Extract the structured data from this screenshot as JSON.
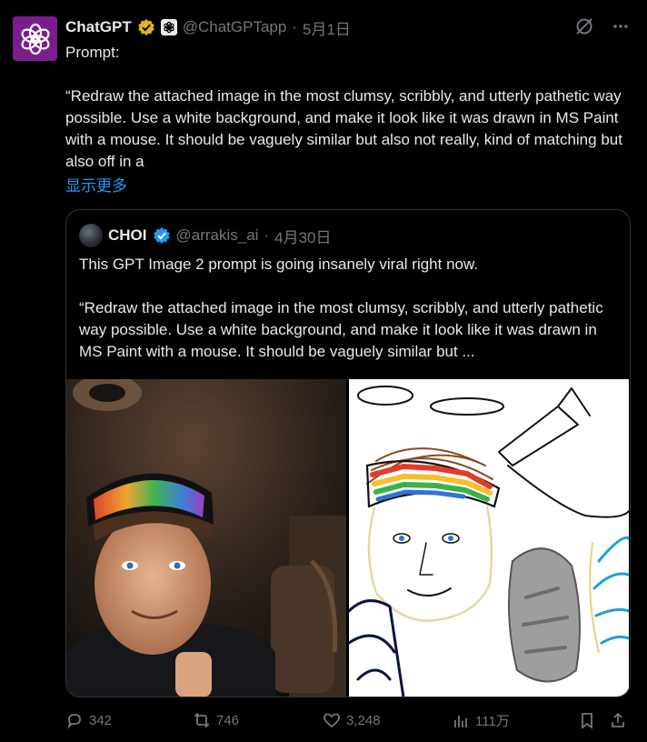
{
  "post": {
    "author_name": "ChatGPT",
    "handle": "@ChatGPTapp",
    "separator": "·",
    "date": "5月1日",
    "text_prompt_label": "Prompt:",
    "text_body": "“Redraw the attached image in the most clumsy, scribbly, and utterly pathetic way possible. Use a white background, and make it look like it was drawn in MS Paint with a mouse. It should be vaguely similar but also not really, kind of matching but also off in a",
    "show_more": "显示更多"
  },
  "quote": {
    "author_name": "CHOI",
    "handle": "@arrakis_ai",
    "separator": "·",
    "date": "4月30日",
    "line1": "This GPT Image 2 prompt is going insanely viral right now.",
    "line2": "“Redraw the attached image in the most clumsy, scribbly, and utterly pathetic way possible. Use a white background, and make it look like it was drawn in MS Paint with a mouse. It should be vaguely similar but ..."
  },
  "actions": {
    "replies": "342",
    "reposts": "746",
    "likes": "3,248",
    "views": "111万"
  },
  "colors": {
    "background": "#000000",
    "text": "#e7e9ea",
    "muted": "#71767b",
    "link": "#1d9bf0",
    "verified_blue": "#1d9bf0",
    "verified_gold": "#e2b719",
    "avatar_purple": "#7a1e8e",
    "border": "#2f3336"
  }
}
